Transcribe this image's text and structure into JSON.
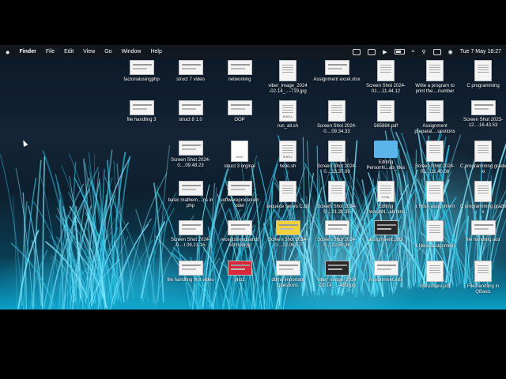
{
  "menubar": {
    "apple_icon": "apple-icon",
    "app_name": "Finder",
    "items": [
      "File",
      "Edit",
      "View",
      "Go",
      "Window",
      "Help"
    ],
    "status_icons": [
      "m-icon",
      "box-icon",
      "play-icon",
      "battery-icon",
      "wifi-icon",
      "search-icon",
      "control-center-icon",
      "siri-icon"
    ],
    "clock": "Tue 7 May  18:27"
  },
  "desktop": {
    "icons": [
      {
        "label": "factorialusingphp",
        "kind": "wide"
      },
      {
        "label": "struct 7 video",
        "kind": "wide"
      },
      {
        "label": "networking",
        "kind": "wide"
      },
      {
        "label": "viber_image_2024 -02-14_...-719.jpg",
        "kind": "doc"
      },
      {
        "label": "Assignment excel.xlsx",
        "kind": "wide"
      },
      {
        "label": "Screen Shot 2024-01....11.44.12",
        "kind": "doc"
      },
      {
        "label": "Write a program to print the....number",
        "kind": "doc"
      },
      {
        "label": "C programming",
        "kind": "doc"
      },
      {
        "label": "file handling 3",
        "kind": "wide"
      },
      {
        "label": "struct 8 1.0",
        "kind": "wide"
      },
      {
        "label": "OOP",
        "kind": "wide"
      },
      {
        "label": "run_all.sh",
        "kind": "doc",
        "tag": "SHELL"
      },
      {
        "label": "Screen Shot 2024-0....09.34.33",
        "kind": "doc"
      },
      {
        "label": "565884.pdf",
        "kind": "doc"
      },
      {
        "label": "Assignment preparat....uestions",
        "kind": "doc"
      },
      {
        "label": "Screen Shot 2023-12....16.43.53",
        "kind": "wide"
      },
      {
        "label": "Screen Shot 2024-0....09.48.23",
        "kind": "wide"
      },
      {
        "label": "struct 3 orginal",
        "kind": "mov",
        "tag": "MOV"
      },
      {
        "label": "hello.sh",
        "kind": "doc",
        "tag": "SHELL"
      },
      {
        "label": "Screen Shot 2024-0....13.37.09",
        "kind": "doc"
      },
      {
        "label": "Editing PersonN...ab_files",
        "kind": "folder"
      },
      {
        "label": "Screen Shot 2024-01....11.40.08",
        "kind": "doc"
      },
      {
        "label": "C programming grade xi",
        "kind": "doc"
      },
      {
        "label": "basic mathem....ns in php",
        "kind": "wide"
      },
      {
        "label": "softwareprocessm odel",
        "kind": "wide"
      },
      {
        "label": "sequece series C.drt",
        "kind": "doc"
      },
      {
        "label": "Screen Shot 2024-0....21.21.35",
        "kind": "doc"
      },
      {
        "label": "Editing PersonN...ab.html",
        "kind": "doc",
        "tag": "HTML"
      },
      {
        "label": "1 Hour assignment",
        "kind": "doc"
      },
      {
        "label": "C programming grade x",
        "kind": "doc"
      },
      {
        "label": "Screen Shot 2024-0....t 09.21.16",
        "kind": "wide"
      },
      {
        "label": "recentstrendsandt echnology",
        "kind": "wide"
      },
      {
        "label": "Screen Shot 2024-0....22.06.57",
        "kind": "yellow"
      },
      {
        "label": "Screen Shot 2024-0....22.50.36",
        "kind": "wide"
      },
      {
        "label": "assignment.pptx",
        "kind": "dark"
      },
      {
        "label": "1 Hour assignment",
        "kind": "doc"
      },
      {
        "label": "file handling last",
        "kind": "wide"
      },
      {
        "label": "file handling first video",
        "kind": "wide"
      },
      {
        "label": "php1",
        "kind": "red"
      },
      {
        "label": "dbms important questions",
        "kind": "wide"
      },
      {
        "label": "viber_image_2024 -02-14_...-489.jpg",
        "kind": "dark"
      },
      {
        "label": "Assignment.xlsx",
        "kind": "wide"
      },
      {
        "label": "meroshare.pdf",
        "kind": "doc"
      },
      {
        "label": "File handling in QBasic",
        "kind": "doc"
      }
    ]
  }
}
